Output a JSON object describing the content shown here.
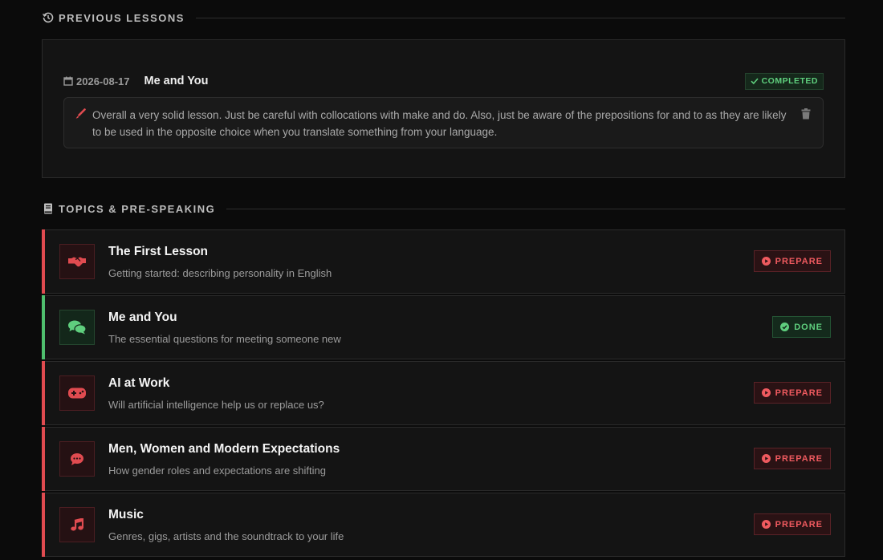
{
  "sections": {
    "previous_lessons": "PREVIOUS LESSONS",
    "topics": "TOPICS & PRE-SPEAKING"
  },
  "previous_lesson": {
    "date": "2026-08-17",
    "title": "Me and You",
    "status": "COMPLETED",
    "note": "Overall a very solid lesson. Just be careful with collocations with make and do. Also, just be aware of the prepositions for and to as they are likely to be used in the opposite choice when you translate something from your language."
  },
  "topics": [
    {
      "title": "The First Lesson",
      "subtitle": "Getting started: describing personality in English",
      "action": "PREPARE",
      "state": "todo",
      "icon": "handshake-icon"
    },
    {
      "title": "Me and You",
      "subtitle": "The essential questions for meeting someone new",
      "action": "DONE",
      "state": "done",
      "icon": "comments-icon"
    },
    {
      "title": "AI at Work",
      "subtitle": "Will artificial intelligence help us or replace us?",
      "action": "PREPARE",
      "state": "todo",
      "icon": "gamepad-icon"
    },
    {
      "title": "Men, Women and Modern Expectations",
      "subtitle": "How gender roles and expectations are shifting",
      "action": "PREPARE",
      "state": "todo",
      "icon": "speech-bubble-icon"
    },
    {
      "title": "Music",
      "subtitle": "Genres, gigs, artists and the soundtrack to your life",
      "action": "PREPARE",
      "state": "todo",
      "icon": "music-note-icon"
    }
  ],
  "colors": {
    "accent_red": "#e04b50",
    "accent_green": "#4fbf6e",
    "background": "#0b0b0b",
    "card": "#141414"
  }
}
